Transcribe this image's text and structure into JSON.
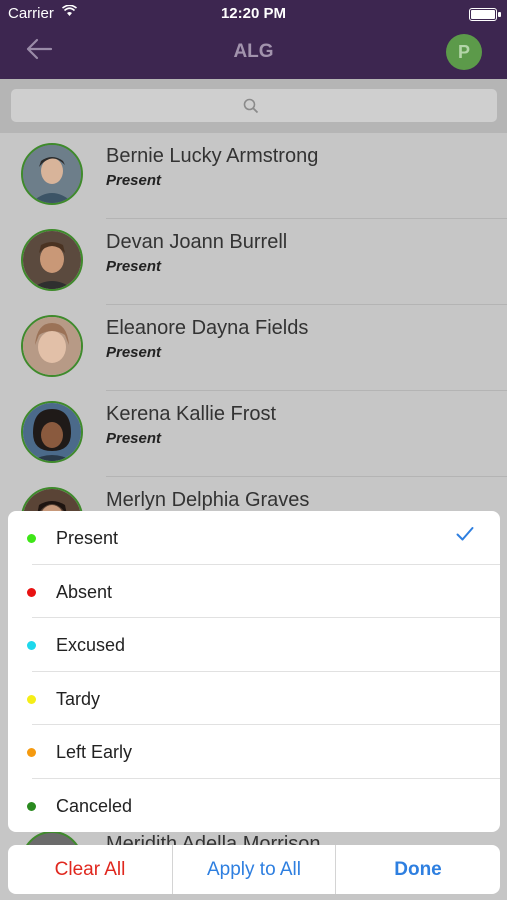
{
  "status_bar": {
    "carrier": "Carrier",
    "time": "12:20 PM"
  },
  "nav": {
    "back_icon": "arrow-left-icon",
    "title": "ALG",
    "avatar_letter": "P"
  },
  "search": {
    "icon": "magnifier-icon"
  },
  "students": [
    {
      "name": "Bernie Lucky Armstrong",
      "status": "Present"
    },
    {
      "name": "Devan Joann Burrell",
      "status": "Present"
    },
    {
      "name": "Eleanore Dayna Fields",
      "status": "Present"
    },
    {
      "name": "Kerena Kallie Frost",
      "status": "Present"
    },
    {
      "name": "Merlyn Delphia Graves"
    },
    {
      "name": "Meridith Adella Morrison"
    }
  ],
  "picker": {
    "selected": "Present",
    "options": [
      {
        "label": "Present",
        "color": "#3ee617"
      },
      {
        "label": "Absent",
        "color": "#e81212"
      },
      {
        "label": "Excused",
        "color": "#1ed8ec"
      },
      {
        "label": "Tardy",
        "color": "#f5ee17"
      },
      {
        "label": "Left Early",
        "color": "#f59a0f"
      },
      {
        "label": "Canceled",
        "color": "#2a8a1f"
      }
    ]
  },
  "actions": {
    "clear_all": "Clear All",
    "apply_to_all": "Apply to All",
    "done": "Done"
  }
}
